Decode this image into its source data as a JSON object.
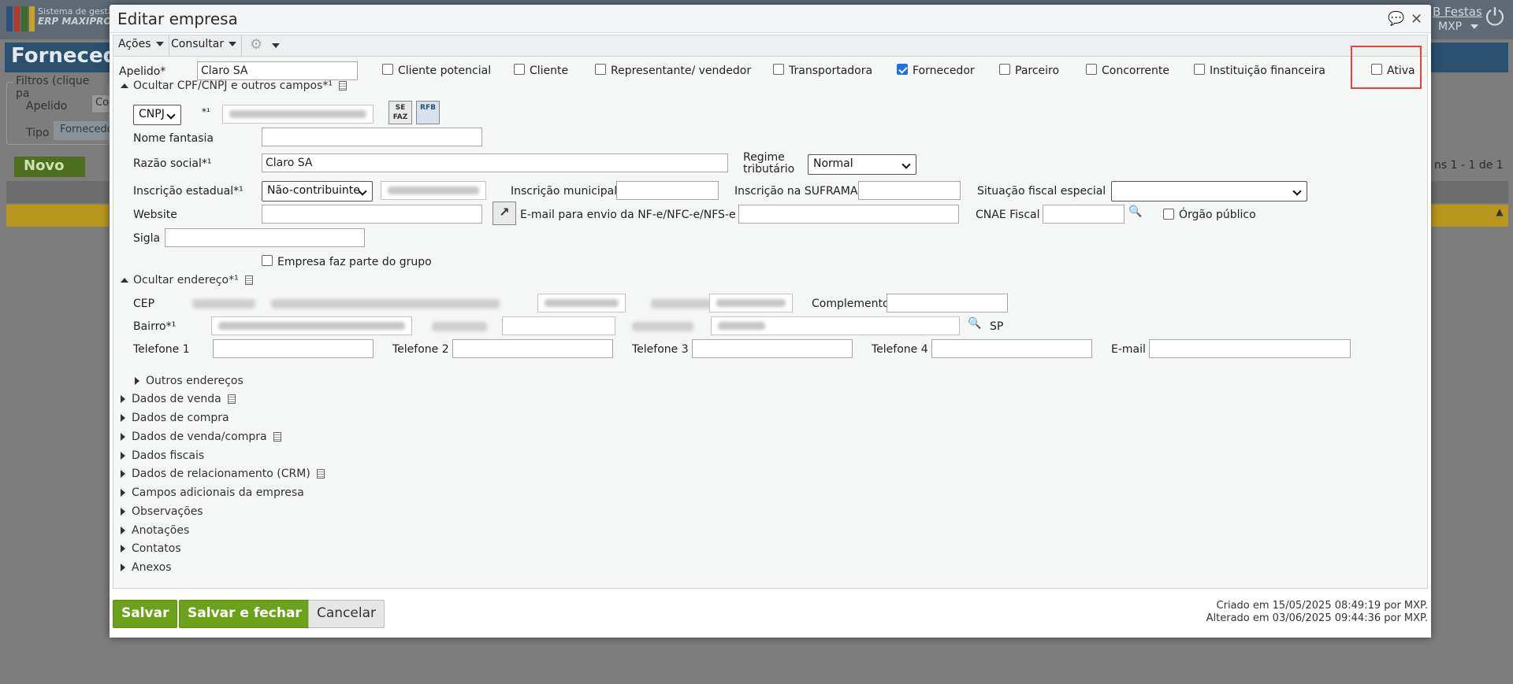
{
  "background": {
    "brand_line1": "Sistema de gestã",
    "brand_line2": "ERP MAXIPRO",
    "festas": "B Festas",
    "company": "MXP",
    "page_title": "Fornecedo",
    "filters_legend": "Filtros (clique pa",
    "filter_apelido": "Apelido",
    "filter_tipo": "Tipo",
    "filter_input1": "Co",
    "filter_tipo_value": "Fornecedo",
    "novo": "Novo",
    "pagination": "ns 1 - 1 de 1"
  },
  "modal": {
    "title": "Editar empresa",
    "menus": [
      "Ações",
      "Consultar"
    ]
  },
  "form": {
    "apelido_label": "Apelido*",
    "apelido_value": "Claro SA",
    "roles": [
      {
        "label": "Cliente potencial",
        "checked": false
      },
      {
        "label": "Cliente",
        "checked": false
      },
      {
        "label": "Representante/ vendedor",
        "checked": false
      },
      {
        "label": "Transportadora",
        "checked": false
      },
      {
        "label": "Fornecedor",
        "checked": true
      },
      {
        "label": "Parceiro",
        "checked": false
      },
      {
        "label": "Concorrente",
        "checked": false
      },
      {
        "label": "Instituição financeira",
        "checked": false
      }
    ],
    "ativa_label": "Ativa",
    "ativa_checked": false,
    "section_cpf": "Ocultar CPF/CNPJ e outros campos*¹",
    "doc_type": "CNPJ",
    "doc_req": "*¹",
    "sefaz_icon_text": "SE FAZ",
    "rfb_icon_text": "RFB",
    "nome_fantasia_label": "Nome fantasia",
    "nome_fantasia_value": "",
    "razao_social_label": "Razão social*¹",
    "razao_social_value": "Claro SA",
    "regime_label_1": "Regime",
    "regime_label_2": "tributário",
    "regime_value": "Normal",
    "ie_label": "Inscrição estadual*¹",
    "ie_type": "Não-contribuinte",
    "im_label": "Inscrição municipal",
    "suframa_label": "Inscrição na SUFRAMA",
    "situacao_label": "Situação fiscal especial",
    "situacao_value": "",
    "website_label": "Website",
    "email_nfe_label": "E-mail para envio da NF-e/NFC-e/NFS-e",
    "cnae_label": "CNAE Fiscal",
    "orgao_label": "Órgão público",
    "sigla_label": "Sigla",
    "grupo_label": "Empresa faz parte do grupo",
    "section_endereco": "Ocultar endereço*¹",
    "cep_label": "CEP",
    "complemento_label": "Complemento",
    "bairro_label": "Bairro*¹",
    "uf": "SP",
    "tel1_label": "Telefone 1",
    "tel2_label": "Telefone 2",
    "tel3_label": "Telefone 3",
    "tel4_label": "Telefone 4",
    "email_label": "E-mail",
    "outros_enderecos": "Outros endereços",
    "sections": [
      {
        "label": "Dados de venda",
        "doc": true
      },
      {
        "label": "Dados de compra",
        "doc": false
      },
      {
        "label": "Dados de venda/compra",
        "doc": true
      },
      {
        "label": "Dados fiscais",
        "doc": false
      },
      {
        "label": "Dados de relacionamento (CRM)",
        "doc": true
      },
      {
        "label": "Campos adicionais da empresa",
        "doc": false
      },
      {
        "label": "Observações",
        "doc": false
      },
      {
        "label": "Anotações",
        "doc": false
      },
      {
        "label": "Contatos",
        "doc": false
      },
      {
        "label": "Anexos",
        "doc": false
      }
    ]
  },
  "footer": {
    "salvar": "Salvar",
    "salvar_fechar": "Salvar e fechar",
    "cancelar": "Cancelar",
    "criado": "Criado em 15/05/2025 08:49:19 por MXP.",
    "alterado": "Alterado em 03/06/2025 09:44:36 por MXP."
  },
  "colors": {
    "highlight": "#e0463c",
    "primary_button": "#6aa31b",
    "checkbox_checked": "#1a73e8"
  }
}
